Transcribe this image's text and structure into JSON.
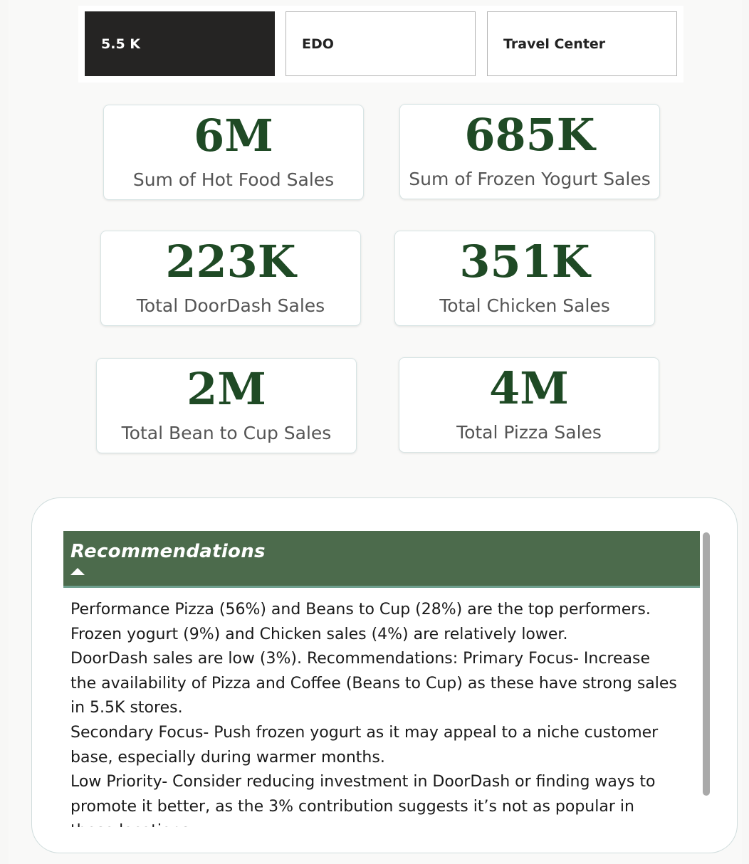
{
  "slicer": {
    "options": [
      "5.5 K",
      "EDO",
      "Travel Center"
    ],
    "selected": "5.5 K"
  },
  "kpis": {
    "hot_food": {
      "value": "6M",
      "label": "Sum of Hot Food Sales"
    },
    "frozen_yogurt": {
      "value": "685K",
      "label": "Sum of Frozen Yogurt Sales"
    },
    "doordash": {
      "value": "223K",
      "label": "Total DoorDash Sales"
    },
    "chicken": {
      "value": "351K",
      "label": "Total Chicken Sales"
    },
    "bean_to_cup": {
      "value": "2M",
      "label": "Total Bean to Cup Sales"
    },
    "pizza": {
      "value": "4M",
      "label": "Total Pizza Sales"
    }
  },
  "recommendations": {
    "title": "Recommendations",
    "lines": [
      "Performance Pizza (56%) and Beans to Cup (28%) are the top performers.",
      "Frozen yogurt (9%) and Chicken sales (4%) are relatively lower.",
      "DoorDash sales are low (3%). Recommendations: Primary Focus- Increase",
      "the availability of Pizza and Coffee (Beans to Cup) as these have strong sales",
      "in 5.5K stores.",
      "Secondary Focus- Push frozen yogurt as it may appeal to a niche customer",
      "base, especially during warmer months.",
      "Low Priority- Consider reducing investment in DoorDash or finding ways to",
      "promote it better, as the 3% contribution suggests it’s not as popular in",
      "these locations."
    ]
  },
  "colors": {
    "kpi_value": "#1f4a25",
    "header_bg": "#4c6b4c",
    "slicer_selected_bg": "#252423"
  }
}
